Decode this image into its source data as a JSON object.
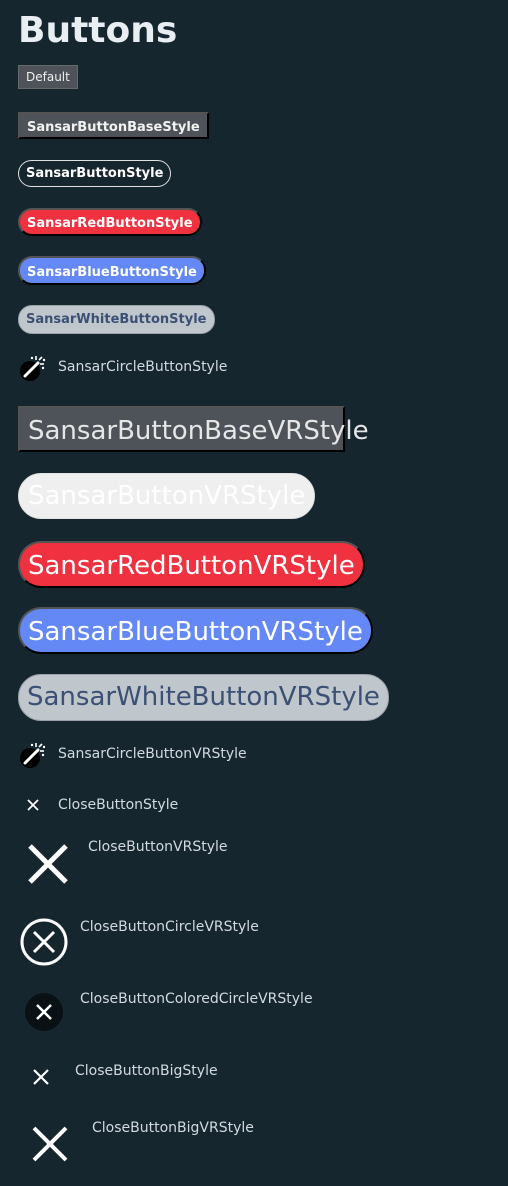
{
  "page": {
    "title": "Buttons"
  },
  "buttons": {
    "default": "Default",
    "base": "SansarButtonBaseStyle",
    "outline": "SansarButtonStyle",
    "red": "SansarRedButtonStyle",
    "blue": "SansarBlueButtonStyle",
    "white": "SansarWhiteButtonStyle",
    "circle": "SansarCircleButtonStyle",
    "base_vr": "SansarButtonBaseVRStyle",
    "outline_vr": "SansarButtonVRStyle",
    "red_vr": "SansarRedButtonVRStyle",
    "blue_vr": "SansarBlueButtonVRStyle",
    "white_vr": "SansarWhiteButtonVRStyle",
    "circle_vr": "SansarCircleButtonVRStyle"
  },
  "close_buttons": {
    "close": "CloseButtonStyle",
    "close_vr": "CloseButtonVRStyle",
    "close_circle_vr": "CloseButtonCircleVRStyle",
    "close_colored_circle_vr": "CloseButtonColoredCircleVRStyle",
    "close_big": "CloseButtonBigStyle",
    "close_big_vr": "CloseButtonBigVRStyle"
  },
  "icons": {
    "circle_icon": "magic-wand-icon",
    "close_icon": "close-icon"
  },
  "colors": {
    "background": "#16262f",
    "red": "#f0313f",
    "blue": "#6488f5",
    "white_button": "#bfc6cc",
    "white_button_text": "#3b5074",
    "base_button": "#4d5358"
  }
}
